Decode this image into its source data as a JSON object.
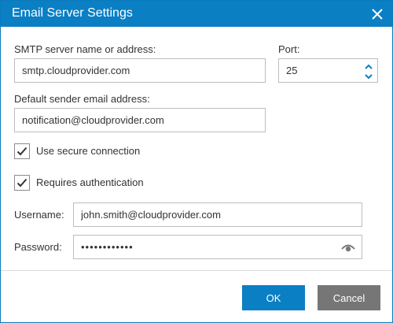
{
  "dialog": {
    "title": "Email Server Settings",
    "accent": "#0a7fc4"
  },
  "smtp": {
    "label": "SMTP server name or address:",
    "value": "smtp.cloudprovider.com"
  },
  "port": {
    "label": "Port:",
    "value": "25"
  },
  "sender": {
    "label": "Default sender email address:",
    "value": "notification@cloudprovider.com"
  },
  "secure": {
    "label": "Use secure connection",
    "checked": true
  },
  "auth": {
    "label": "Requires authentication",
    "checked": true
  },
  "username": {
    "label": "Username:",
    "value": "john.smith@cloudprovider.com"
  },
  "password": {
    "label": "Password:",
    "value": "••••••••••••"
  },
  "buttons": {
    "ok": "OK",
    "cancel": "Cancel"
  }
}
